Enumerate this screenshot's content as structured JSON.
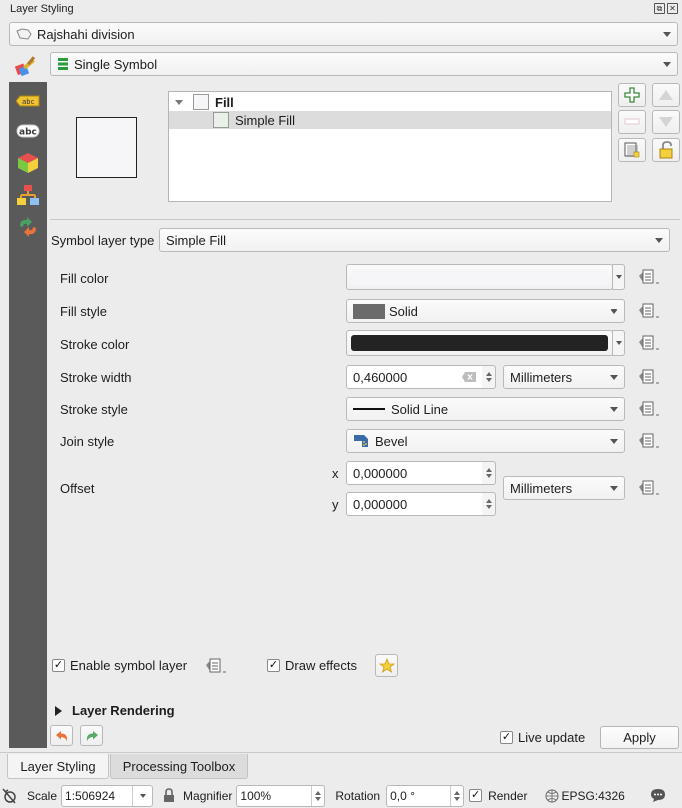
{
  "panel": {
    "title": "Layer Styling",
    "float_icon": "float-icon",
    "close_icon": "close-icon"
  },
  "layer_selector": {
    "value": "Rajshahi division",
    "icon": "polygon-layer-icon"
  },
  "renderer": {
    "value": "Single Symbol",
    "icon": "single-symbol-icon"
  },
  "sidebar": {
    "items": [
      {
        "name": "symbology",
        "icon": "paintbrush-icon"
      },
      {
        "name": "labels",
        "icon": "label-abc-icon"
      },
      {
        "name": "masks",
        "icon": "mask-abc-icon"
      },
      {
        "name": "3d-view",
        "icon": "3d-cube-icon"
      },
      {
        "name": "diagrams",
        "icon": "diagram-icon"
      },
      {
        "name": "history",
        "icon": "history-icon"
      }
    ]
  },
  "symbol_tree": {
    "items": [
      {
        "label": "Fill",
        "level": 0,
        "expanded": true,
        "bold": true,
        "selected": false
      },
      {
        "label": "Simple Fill",
        "level": 1,
        "bold": false,
        "selected": true
      }
    ]
  },
  "tree_buttons": {
    "add": "add-layer-icon",
    "remove": "remove-layer-icon",
    "up": "move-up-icon",
    "down": "move-down-icon",
    "duplicate": "duplicate-layer-icon",
    "lock": "unlock-color-icon"
  },
  "symbol_layer_type": {
    "label": "Symbol layer type",
    "value": "Simple Fill"
  },
  "properties": {
    "fill_color": {
      "label": "Fill color",
      "color": "#f6f6f8"
    },
    "fill_style": {
      "label": "Fill style",
      "value": "Solid",
      "swatch": "#6b6b6b"
    },
    "stroke_color": {
      "label": "Stroke color",
      "color": "#232323"
    },
    "stroke_width": {
      "label": "Stroke width",
      "value": "0,460000",
      "unit": "Millimeters"
    },
    "stroke_style": {
      "label": "Stroke style",
      "value": "Solid Line"
    },
    "join_style": {
      "label": "Join style",
      "value": "Bevel"
    },
    "offset": {
      "label": "Offset",
      "x_label": "x",
      "x_value": "0,000000",
      "y_label": "y",
      "y_value": "0,000000",
      "unit": "Millimeters"
    }
  },
  "enable_symbol_layer": {
    "label": "Enable symbol layer",
    "checked": true
  },
  "draw_effects": {
    "label": "Draw effects",
    "checked": true
  },
  "layer_rendering": {
    "label": "Layer Rendering",
    "expanded": false
  },
  "live_update": {
    "label": "Live update",
    "checked": true
  },
  "apply_label": "Apply",
  "tabs": [
    {
      "label": "Layer Styling",
      "active": true
    },
    {
      "label": "Processing Toolbox",
      "active": false
    }
  ],
  "statusbar": {
    "scale_label": "Scale",
    "scale_value": "1:506924",
    "magnifier_label": "Magnifier",
    "magnifier_value": "100%",
    "rotation_label": "Rotation",
    "rotation_value": "0,0 °",
    "render_label": "Render",
    "render_checked": true,
    "crs_label": "EPSG:4326"
  },
  "check_glyph": "✓"
}
